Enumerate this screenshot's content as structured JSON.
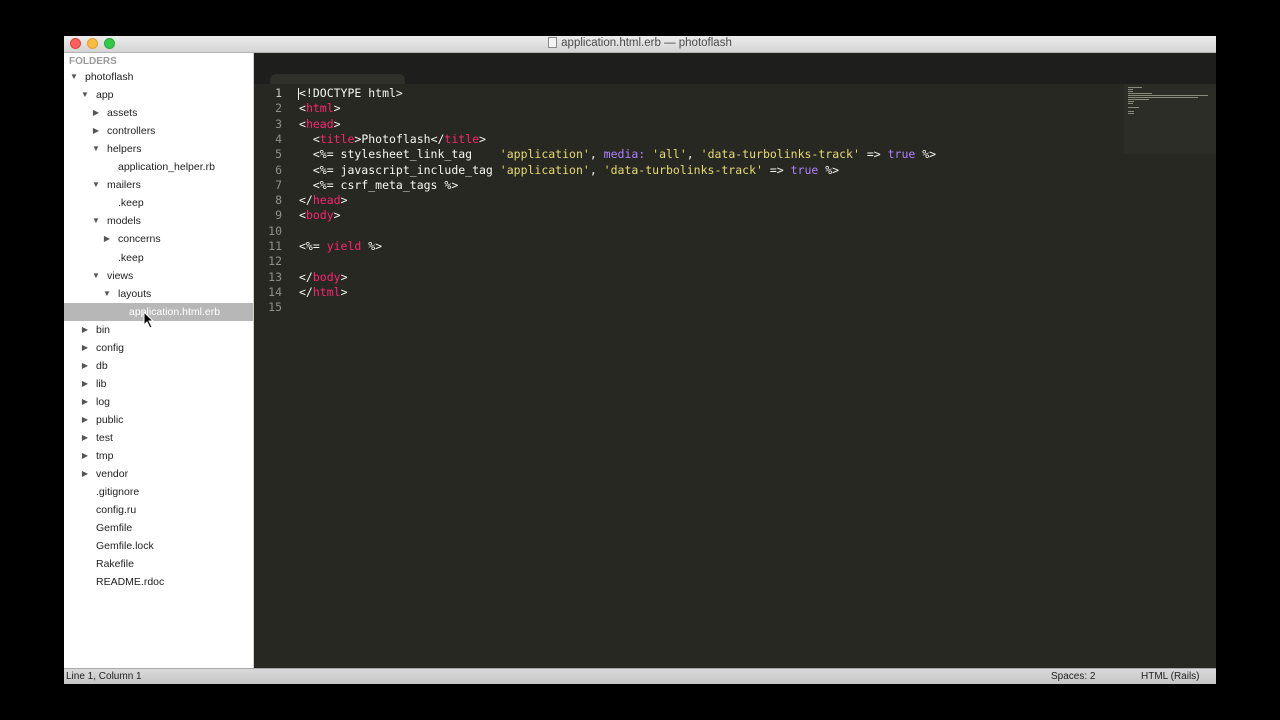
{
  "window": {
    "title": "application.html.erb — photoflash"
  },
  "sidebar": {
    "header": "FOLDERS",
    "items": [
      {
        "label": "photoflash",
        "depth": 0,
        "type": "folder",
        "open": true
      },
      {
        "label": "app",
        "depth": 1,
        "type": "folder",
        "open": true
      },
      {
        "label": "assets",
        "depth": 2,
        "type": "folder",
        "open": false
      },
      {
        "label": "controllers",
        "depth": 2,
        "type": "folder",
        "open": false
      },
      {
        "label": "helpers",
        "depth": 2,
        "type": "folder",
        "open": true
      },
      {
        "label": "application_helper.rb",
        "depth": 3,
        "type": "file"
      },
      {
        "label": "mailers",
        "depth": 2,
        "type": "folder",
        "open": true
      },
      {
        "label": ".keep",
        "depth": 3,
        "type": "file"
      },
      {
        "label": "models",
        "depth": 2,
        "type": "folder",
        "open": true
      },
      {
        "label": "concerns",
        "depth": 3,
        "type": "folder",
        "open": false
      },
      {
        "label": ".keep",
        "depth": 3,
        "type": "file"
      },
      {
        "label": "views",
        "depth": 2,
        "type": "folder",
        "open": true
      },
      {
        "label": "layouts",
        "depth": 3,
        "type": "folder",
        "open": true
      },
      {
        "label": "application.html.erb",
        "depth": 4,
        "type": "file",
        "selected": true
      },
      {
        "label": "bin",
        "depth": 1,
        "type": "folder",
        "open": false
      },
      {
        "label": "config",
        "depth": 1,
        "type": "folder",
        "open": false
      },
      {
        "label": "db",
        "depth": 1,
        "type": "folder",
        "open": false
      },
      {
        "label": "lib",
        "depth": 1,
        "type": "folder",
        "open": false
      },
      {
        "label": "log",
        "depth": 1,
        "type": "folder",
        "open": false
      },
      {
        "label": "public",
        "depth": 1,
        "type": "folder",
        "open": false
      },
      {
        "label": "test",
        "depth": 1,
        "type": "folder",
        "open": false
      },
      {
        "label": "tmp",
        "depth": 1,
        "type": "folder",
        "open": false
      },
      {
        "label": "vendor",
        "depth": 1,
        "type": "folder",
        "open": false
      },
      {
        "label": ".gitignore",
        "depth": 1,
        "type": "file"
      },
      {
        "label": "config.ru",
        "depth": 1,
        "type": "file"
      },
      {
        "label": "Gemfile",
        "depth": 1,
        "type": "file"
      },
      {
        "label": "Gemfile.lock",
        "depth": 1,
        "type": "file"
      },
      {
        "label": "Rakefile",
        "depth": 1,
        "type": "file"
      },
      {
        "label": "README.rdoc",
        "depth": 1,
        "type": "file"
      }
    ]
  },
  "editor": {
    "current_line": 1,
    "lines": [
      {
        "n": "1",
        "tokens": [
          [
            "<!DOCTYPE html>",
            ""
          ]
        ]
      },
      {
        "n": "2",
        "tokens": [
          [
            "<",
            ""
          ],
          [
            "html",
            "tag"
          ],
          [
            ">",
            ""
          ]
        ]
      },
      {
        "n": "3",
        "tokens": [
          [
            "<",
            ""
          ],
          [
            "head",
            "tag"
          ],
          [
            ">",
            ""
          ]
        ]
      },
      {
        "n": "4",
        "tokens": [
          [
            "  <",
            ""
          ],
          [
            "title",
            "tag"
          ],
          [
            ">Photoflash</",
            ""
          ],
          [
            "title",
            "tag"
          ],
          [
            ">",
            ""
          ]
        ]
      },
      {
        "n": "5",
        "tokens": [
          [
            "  <%= stylesheet_link_tag    ",
            ""
          ],
          [
            "'application'",
            "str"
          ],
          [
            ", ",
            ""
          ],
          [
            "media:",
            "con"
          ],
          [
            " ",
            ""
          ],
          [
            "'all'",
            "str"
          ],
          [
            ", ",
            ""
          ],
          [
            "'data-turbolinks-track'",
            "str"
          ],
          [
            " => ",
            ""
          ],
          [
            "true",
            "con"
          ],
          [
            " %>",
            ""
          ]
        ]
      },
      {
        "n": "6",
        "tokens": [
          [
            "  <%= javascript_include_tag ",
            ""
          ],
          [
            "'application'",
            "str"
          ],
          [
            ", ",
            ""
          ],
          [
            "'data-turbolinks-track'",
            "str"
          ],
          [
            " => ",
            ""
          ],
          [
            "true",
            "con"
          ],
          [
            " %>",
            ""
          ]
        ]
      },
      {
        "n": "7",
        "tokens": [
          [
            "  <%= csrf_meta_tags %>",
            ""
          ]
        ]
      },
      {
        "n": "8",
        "tokens": [
          [
            "</",
            ""
          ],
          [
            "head",
            "tag"
          ],
          [
            ">",
            ""
          ]
        ]
      },
      {
        "n": "9",
        "tokens": [
          [
            "<",
            ""
          ],
          [
            "body",
            "tag"
          ],
          [
            ">",
            ""
          ]
        ]
      },
      {
        "n": "10",
        "tokens": []
      },
      {
        "n": "11",
        "tokens": [
          [
            "<%= ",
            ""
          ],
          [
            "yield",
            "tag"
          ],
          [
            " %>",
            ""
          ]
        ]
      },
      {
        "n": "12",
        "tokens": []
      },
      {
        "n": "13",
        "tokens": [
          [
            "</",
            ""
          ],
          [
            "body",
            "tag"
          ],
          [
            ">",
            ""
          ]
        ]
      },
      {
        "n": "14",
        "tokens": [
          [
            "</",
            ""
          ],
          [
            "html",
            "tag"
          ],
          [
            ">",
            ""
          ]
        ]
      },
      {
        "n": "15",
        "tokens": []
      }
    ]
  },
  "statusbar": {
    "position": "Line 1, Column 1",
    "spaces": "Spaces: 2",
    "syntax": "HTML (Rails)"
  },
  "colors": {
    "editor_bg": "#272822",
    "tag": "#f92672",
    "string": "#e6db74",
    "constant": "#ae81ff",
    "text": "#f8f8f2"
  }
}
